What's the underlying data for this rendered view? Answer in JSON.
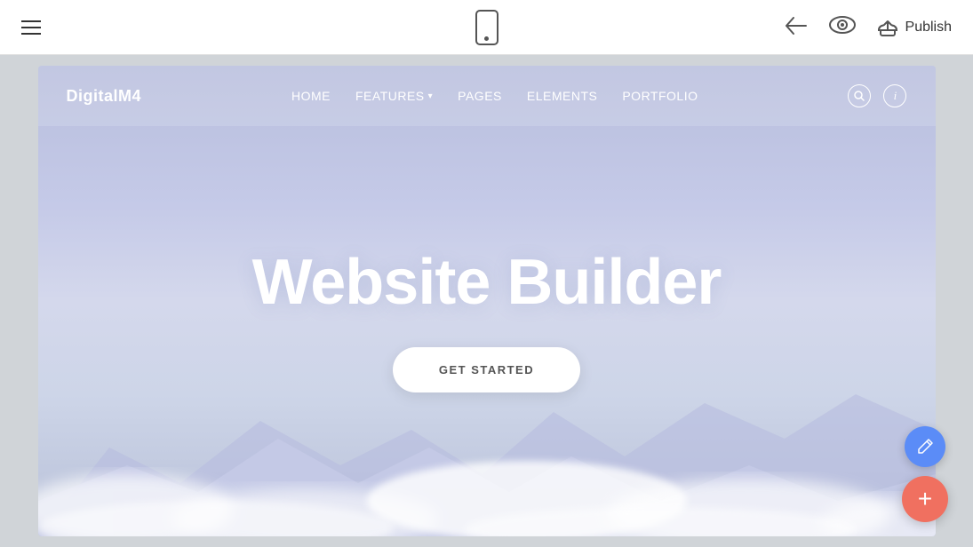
{
  "toolbar": {
    "hamburger_label": "menu",
    "mobile_icon_label": "mobile preview",
    "back_label": "back",
    "preview_label": "preview",
    "publish_label": "Publish"
  },
  "site": {
    "logo": "DigitalM4",
    "nav": {
      "items": [
        {
          "label": "HOME",
          "has_dropdown": false
        },
        {
          "label": "FEATURES",
          "has_dropdown": true
        },
        {
          "label": "PAGES",
          "has_dropdown": false
        },
        {
          "label": "ELEMENTS",
          "has_dropdown": false
        },
        {
          "label": "PORTFOLIO",
          "has_dropdown": false
        }
      ]
    },
    "hero": {
      "title": "Website Builder",
      "cta_label": "GET STARTED"
    }
  },
  "fab": {
    "edit_icon": "✏",
    "add_icon": "+"
  }
}
